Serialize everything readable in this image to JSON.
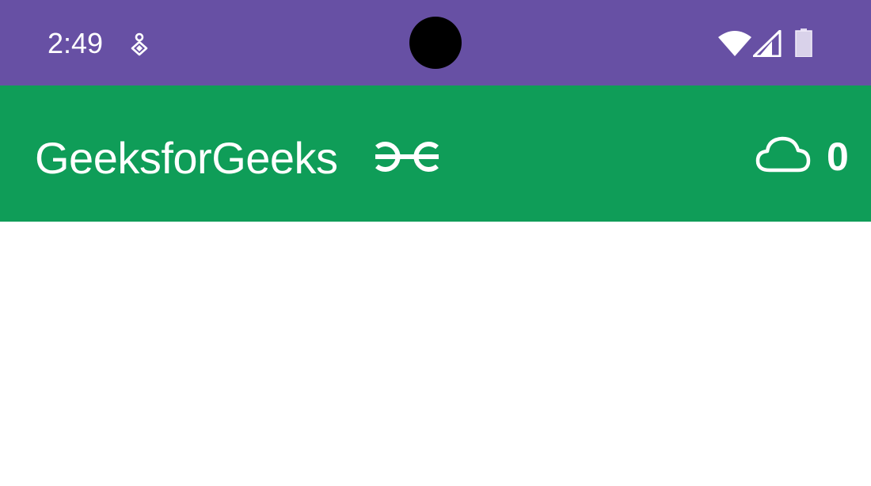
{
  "status_bar": {
    "time": "2:49",
    "background_color": "#6750a4",
    "notification_icon": "notification-badge-icon",
    "wifi_icon": "wifi-icon",
    "signal_icon": "cell-signal-icon",
    "battery_icon": "battery-icon"
  },
  "app_bar": {
    "title": "GeeksforGeeks",
    "logo_icon": "gfg-logo-icon",
    "background_color": "#0f9d58",
    "cloud_icon": "cloud-icon",
    "cloud_count": "0"
  },
  "content": {
    "background_color": "#ffffff"
  }
}
